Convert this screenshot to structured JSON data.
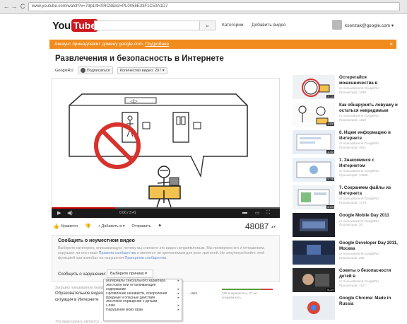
{
  "browser": {
    "back": "←",
    "forward": "→",
    "reload": "C",
    "url": "www.youtube.com/watch?v=7dp1rtHXRC8&list=PL0058E33F1C50A1D7"
  },
  "header": {
    "logo_you": "You",
    "logo_tube": "Tube",
    "search_icon": "⌕",
    "nav_categories": "Категории",
    "nav_upload": "Добавить видео",
    "user_email": "ksenzak@google.com",
    "user_chevron": "▾"
  },
  "notice": {
    "text": "Аккаунт принадлежит домену google.com",
    "link": "Подробнее",
    "close": "×"
  },
  "video": {
    "title": "Развлечения и безопасность в Интернете",
    "channel": "GoogleRU",
    "subscribe": "Подписаться",
    "video_count": "Количество видео: 207 ▾",
    "time": "0:00 / 3:41",
    "progress": 0.28
  },
  "actions": {
    "like": "Нравится",
    "dislike": "",
    "add_to": "+ Добавить в ▾",
    "share": "Отправить",
    "flag": "⚑",
    "views": "48087",
    "stats_icon": "▴▾"
  },
  "report": {
    "title": "Сообщить о неуместном видео",
    "desc_1": "Выберите категорию, описывающую, почему вы считаете это видео неприемлемым. Мы проверяем его и отправляем, нарушает ли оно наши ",
    "desc_link_1": "Правила сообщества",
    "desc_2": " и является ли приемлемым для всех зрителей. Не злоупотребляйте этой функцией при жалобах на нарушения ",
    "desc_link_2": "Принципов сообщества",
    "desc_end": ".",
    "label": "Сообщить о нарушении:",
    "select": "Выберите причину ▾"
  },
  "menu": [
    {
      "label": "Материалы сексуального характера",
      "arrow": "▸"
    },
    {
      "label": "Жестокое или отталкивающее",
      "arrow": ""
    },
    {
      "label": "содержание",
      "arrow": "▸"
    },
    {
      "label": "Проявление ненависти, оскорбления",
      "arrow": "▸"
    },
    {
      "label": "Вредные и опасные действия",
      "arrow": "▸"
    },
    {
      "label": "Жестокое обращение с детьми",
      "arrow": ""
    },
    {
      "label": "Спам",
      "arrow": "▸"
    },
    {
      "label": "Нарушение моих прав",
      "arrow": "▸"
    }
  ],
  "below": {
    "grey_line": "Загрузил пользователь GoogleRU",
    "title_1": "Образовательное видео",
    "title_2": "ситуация в Интернете",
    "mid": "...ных",
    "stats_1": "185 понравилось, 27 не",
    "stats_2": "понравилось",
    "footer": "Эта видеозапись является ..."
  },
  "sidebar": [
    {
      "title": "Остерегайся мошенничества в",
      "meta_1": "от пользователя GoogleRU",
      "meta_2": "Просмотров: 1638",
      "duration": "2:13"
    },
    {
      "title": "Как обнаружить ловушку и остаться невредимым",
      "meta_1": "от пользователя GoogleRU",
      "meta_2": "Просмотров: 4160",
      "duration": "2:22"
    },
    {
      "title": "6. Ищем информацию в Интернете",
      "meta_1": "от пользователя GoogleRU",
      "meta_2": "Просмотров: 3911",
      "duration": "1:40"
    },
    {
      "title": "1. Знакомимся с Интернетом",
      "meta_1": "от пользователя GoogleRU",
      "meta_2": "Просмотров: 14588",
      "duration": "2:19"
    },
    {
      "title": "7. Сохраняем файлы из Интернета",
      "meta_1": "от пользователя GoogleRU",
      "meta_2": "Просмотров: 7179",
      "duration": "2:23"
    },
    {
      "title": "Google Mobile Day 2011",
      "meta_1": "от пользователя GoogleRU",
      "meta_2": "Просмотров: 30",
      "duration": ""
    },
    {
      "title": "Google Developer Day 2011, Москва",
      "meta_1": "от пользователя GoogleRU",
      "meta_2": "Просмотров: 289",
      "duration": ""
    },
    {
      "title": "Советы о безопасности детей в",
      "meta_1": "от пользователя GoogleRU",
      "meta_2": "Просмотров: 1127",
      "duration": "5:14"
    },
    {
      "title": "Google Chrome: Made in Russia",
      "meta_1": "",
      "meta_2": "",
      "duration": ""
    }
  ]
}
